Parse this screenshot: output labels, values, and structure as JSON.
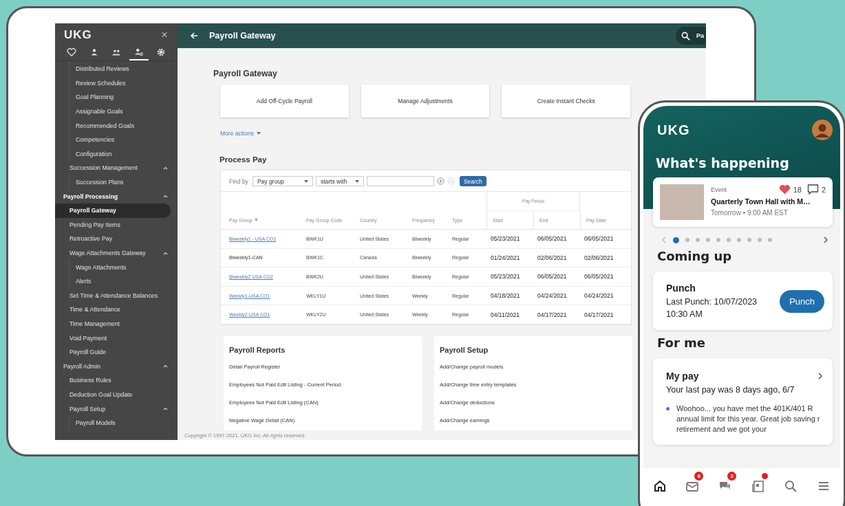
{
  "desktop": {
    "sidebar": {
      "logo": "UKG",
      "close": "×",
      "tabs": [
        {
          "selected": false
        },
        {
          "selected": false
        },
        {
          "selected": false
        },
        {
          "selected": true
        },
        {
          "selected": false
        }
      ],
      "items": [
        {
          "children": [
            {
              "children": [
                {
                  "label": "Distributed Reviews",
                  "selected": false
                },
                {
                  "label": "Review Schedules",
                  "selected": false
                },
                {
                  "label": "Goal Planning",
                  "selected": false
                },
                {
                  "label": "Assignable Goals",
                  "selected": false
                },
                {
                  "label": "Recommended Goals",
                  "selected": false
                },
                {
                  "label": "Competencies",
                  "selected": false
                },
                {
                  "label": "Configuration",
                  "selected": false
                }
              ]
            },
            {
              "label": "Succession Management",
              "selected": false,
              "expanded": true,
              "children": [
                {
                  "label": "Succession Plans",
                  "selected": false
                }
              ]
            }
          ]
        },
        {
          "label": "Payroll Processing",
          "selected": false,
          "expanded": true,
          "children": [
            {
              "label": "Payroll Gateway",
              "selected": true
            },
            {
              "label": "Pending Pay Items",
              "selected": false
            },
            {
              "label": "Retroactive Pay",
              "selected": false
            },
            {
              "label": "Wage Attachments Gateway",
              "selected": false,
              "expanded": true,
              "children": [
                {
                  "label": "Wage Attachments",
                  "selected": false
                },
                {
                  "label": "Alerts",
                  "selected": false
                }
              ]
            },
            {
              "label": "Set Time & Attendance Balances",
              "selected": false
            },
            {
              "label": "Time & Attendance",
              "selected": false
            },
            {
              "label": "Time Management",
              "selected": false
            },
            {
              "label": "Void Payment",
              "selected": false
            },
            {
              "label": "Payroll Guide",
              "selected": false
            }
          ]
        },
        {
          "label": "Payroll Admin",
          "selected": false,
          "expanded": true,
          "children": [
            {
              "label": "Business Rules",
              "selected": false
            },
            {
              "label": "Deduction Goal Update",
              "selected": false
            },
            {
              "label": "Payroll Setup",
              "selected": false,
              "expanded": true,
              "children": [
                {
                  "label": "Payroll Models",
                  "selected": false
                }
              ]
            }
          ]
        }
      ]
    },
    "header": {
      "title": "Payroll Gateway",
      "search_text": "Pa"
    },
    "page_title": "Payroll Gateway",
    "actions": [
      "Add Off-Cycle Payroll",
      "Manage Adjustments",
      "Create Instant Checks"
    ],
    "more_actions": "More actions",
    "process_pay": {
      "title": "Process Pay",
      "find_by": {
        "label": "Find by",
        "field": "Pay group",
        "operator": "starts with",
        "button": "Search"
      },
      "group_label": "Pay Period",
      "columns": [
        {
          "label": "Pay Group",
          "sorted": true,
          "in_group": false
        },
        {
          "label": "Pay Group Code",
          "sorted": false,
          "in_group": false
        },
        {
          "label": "Country",
          "sorted": false,
          "in_group": false
        },
        {
          "label": "Frequency",
          "sorted": false,
          "in_group": false
        },
        {
          "label": "Type",
          "sorted": false,
          "in_group": false
        },
        {
          "label": "Start",
          "sorted": false,
          "in_group": true
        },
        {
          "label": "End",
          "sorted": false,
          "in_group": true
        },
        {
          "label": "Pay Date",
          "sorted": false,
          "in_group": false
        }
      ],
      "rows": [
        {
          "linked": true,
          "cells": [
            "Biweekly1 - USA CO1",
            "BWK1U",
            "United States",
            "Biweekly",
            "Regular",
            "05/23/2021",
            "06/05/2021",
            "06/05/2021"
          ]
        },
        {
          "linked": false,
          "cells": [
            "Biweekly1-CAN",
            "BWK1C",
            "Canada",
            "Biweekly",
            "Regular",
            "01/24/2021",
            "02/06/2021",
            "02/06/2021"
          ]
        },
        {
          "linked": true,
          "cells": [
            "Biweekly2 USA CO2",
            "BWK2U",
            "United States",
            "Biweekly",
            "Regular",
            "05/23/2021",
            "06/05/2021",
            "06/05/2021"
          ]
        },
        {
          "linked": true,
          "cells": [
            "Weekly1-USA CO1",
            "WKLY1U",
            "United States",
            "Weekly",
            "Regular",
            "04/18/2021",
            "04/24/2021",
            "04/24/2021"
          ]
        },
        {
          "linked": true,
          "cells": [
            "Weekly2-USA CO1",
            "WKLY2U",
            "United States",
            "Weekly",
            "Regular",
            "04/11/2021",
            "04/17/2021",
            "04/17/2021"
          ]
        }
      ]
    },
    "panels": [
      {
        "title": "Payroll Reports",
        "items": [
          "Detail Payroll Register",
          "Employees Not Paid Edit Listing - Current Period",
          "Employees Not Paid Edit Listing (CAN)",
          "Negative Wage Detail (CAN)"
        ]
      },
      {
        "title": "Payroll Setup",
        "items": [
          "Add/Change payroll models",
          "Add/Change time entry templates",
          "Add/Change deductions",
          "Add/Change earnings"
        ]
      }
    ],
    "copyright": "Copyright © 1997-2021. UKG Inc. All rights reserved."
  },
  "phone": {
    "logo": "UKG",
    "title": "What's happening",
    "event": {
      "kind_label": "Event",
      "likes": "18",
      "comments": "2",
      "title": "Quarterly Town Hall with M…",
      "time": "Tomorrow • 9:00 AM EST"
    },
    "carousel": [
      {
        "selected": true
      },
      {
        "selected": false
      },
      {
        "selected": false
      },
      {
        "selected": false
      },
      {
        "selected": false
      },
      {
        "selected": false
      },
      {
        "selected": false
      },
      {
        "selected": false
      },
      {
        "selected": false
      },
      {
        "selected": false
      }
    ],
    "coming_up": {
      "title": "Coming up",
      "card_title": "Punch",
      "detail": "Last Punch: 10/07/2023 10:30 AM",
      "button": "Punch"
    },
    "for_me": {
      "title": "For me",
      "card_title": "My pay",
      "subtitle": "Your last pay was 8 days ago, 6/7",
      "note": "Woohoo... you have met the 401K/401 R annual limit for this year. Great job saving r retirement and we got your"
    },
    "nav": [
      {
        "selected": true
      },
      {
        "selected": false,
        "badge": "6"
      },
      {
        "selected": false,
        "badge": "2"
      },
      {
        "selected": false,
        "unread": true
      },
      {
        "selected": false
      },
      {
        "selected": false
      }
    ]
  }
}
